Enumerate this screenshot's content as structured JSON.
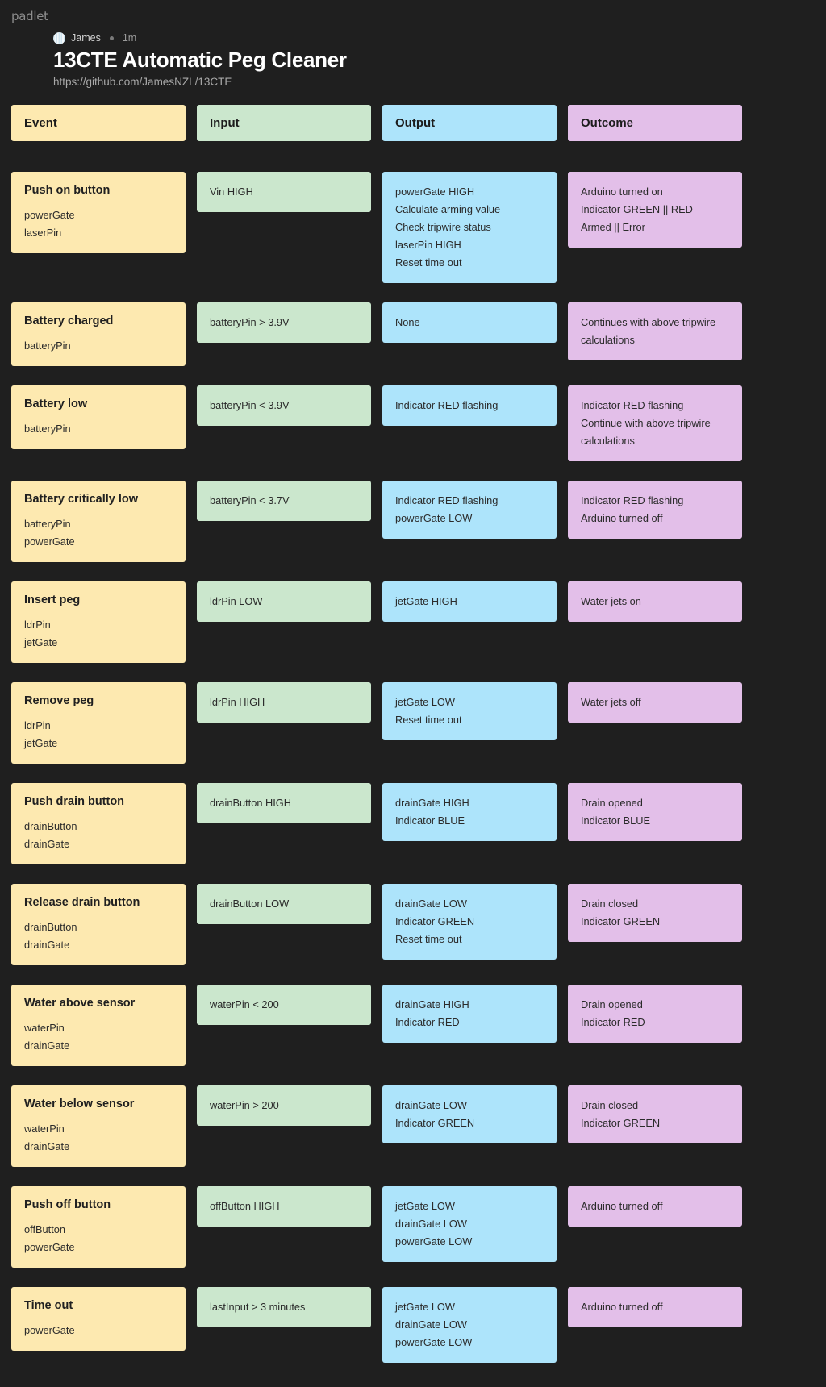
{
  "brand": "padlet",
  "header": {
    "author": "James",
    "timestamp": "1m",
    "title": "13CTE Automatic Peg Cleaner",
    "link": "https://github.com/JamesNZL/13CTE"
  },
  "colors": {
    "background": "#1f1f1f",
    "event": "#fde9b0",
    "input": "#cbe7cd",
    "output": "#ade4fb",
    "outcome": "#e3bfe9"
  },
  "columns": [
    {
      "key": "event",
      "header": "Event"
    },
    {
      "key": "input",
      "header": "Input"
    },
    {
      "key": "output",
      "header": "Output"
    },
    {
      "key": "outcome",
      "header": "Outcome"
    }
  ],
  "rows": [
    {
      "event": {
        "title": "Push on button",
        "lines": [
          "powerGate",
          "laserPin"
        ]
      },
      "input": {
        "lines": [
          "Vin HIGH"
        ]
      },
      "output": {
        "lines": [
          "powerGate HIGH",
          "Calculate arming value",
          "Check tripwire status",
          "laserPin HIGH",
          "Reset time out"
        ]
      },
      "outcome": {
        "lines": [
          "Arduino turned on",
          "Indicator GREEN || RED",
          "Armed || Error"
        ]
      }
    },
    {
      "event": {
        "title": "Battery charged",
        "lines": [
          "batteryPin"
        ]
      },
      "input": {
        "lines": [
          "batteryPin > 3.9V"
        ]
      },
      "output": {
        "lines": [
          "None"
        ]
      },
      "outcome": {
        "lines": [
          "Continues with above tripwire calculations"
        ]
      }
    },
    {
      "event": {
        "title": "Battery low",
        "lines": [
          "batteryPin"
        ]
      },
      "input": {
        "lines": [
          "batteryPin < 3.9V"
        ]
      },
      "output": {
        "lines": [
          "Indicator RED flashing"
        ]
      },
      "outcome": {
        "lines": [
          "Indicator RED flashing",
          "Continue with above tripwire calculations"
        ]
      }
    },
    {
      "event": {
        "title": "Battery critically low",
        "lines": [
          "batteryPin",
          "powerGate"
        ]
      },
      "input": {
        "lines": [
          "batteryPin < 3.7V"
        ]
      },
      "output": {
        "lines": [
          "Indicator RED flashing",
          "powerGate LOW"
        ]
      },
      "outcome": {
        "lines": [
          "Indicator RED flashing",
          "Arduino turned off"
        ]
      }
    },
    {
      "event": {
        "title": "Insert peg",
        "lines": [
          "ldrPin",
          "jetGate"
        ]
      },
      "input": {
        "lines": [
          "ldrPin LOW"
        ]
      },
      "output": {
        "lines": [
          "jetGate HIGH"
        ]
      },
      "outcome": {
        "lines": [
          "Water jets on"
        ]
      }
    },
    {
      "event": {
        "title": "Remove peg",
        "lines": [
          "ldrPin",
          "jetGate"
        ]
      },
      "input": {
        "lines": [
          "ldrPin HIGH"
        ]
      },
      "output": {
        "lines": [
          "jetGate LOW",
          "Reset time out"
        ]
      },
      "outcome": {
        "lines": [
          "Water jets off"
        ]
      }
    },
    {
      "event": {
        "title": "Push drain button",
        "lines": [
          "drainButton",
          "drainGate"
        ]
      },
      "input": {
        "lines": [
          "drainButton HIGH"
        ]
      },
      "output": {
        "lines": [
          "drainGate HIGH",
          "Indicator BLUE"
        ]
      },
      "outcome": {
        "lines": [
          "Drain opened",
          "Indicator BLUE"
        ]
      }
    },
    {
      "event": {
        "title": "Release drain button",
        "lines": [
          "drainButton",
          "drainGate"
        ]
      },
      "input": {
        "lines": [
          "drainButton LOW"
        ]
      },
      "output": {
        "lines": [
          "drainGate LOW",
          "Indicator GREEN",
          "Reset time out"
        ]
      },
      "outcome": {
        "lines": [
          "Drain closed",
          "Indicator GREEN"
        ]
      }
    },
    {
      "event": {
        "title": "Water above sensor",
        "lines": [
          "waterPin",
          "drainGate"
        ]
      },
      "input": {
        "lines": [
          "waterPin < 200"
        ]
      },
      "output": {
        "lines": [
          "drainGate HIGH",
          "Indicator RED"
        ]
      },
      "outcome": {
        "lines": [
          "Drain opened",
          "Indicator RED"
        ]
      }
    },
    {
      "event": {
        "title": "Water below sensor",
        "lines": [
          "waterPin",
          "drainGate"
        ]
      },
      "input": {
        "lines": [
          "waterPin > 200"
        ]
      },
      "output": {
        "lines": [
          "drainGate LOW",
          "Indicator GREEN"
        ]
      },
      "outcome": {
        "lines": [
          "Drain closed",
          "Indicator GREEN"
        ]
      }
    },
    {
      "event": {
        "title": "Push off button",
        "lines": [
          "offButton",
          "powerGate"
        ]
      },
      "input": {
        "lines": [
          "offButton HIGH"
        ]
      },
      "output": {
        "lines": [
          "jetGate LOW",
          "drainGate LOW",
          "powerGate LOW"
        ]
      },
      "outcome": {
        "lines": [
          "Arduino turned off"
        ]
      }
    },
    {
      "event": {
        "title": "Time out",
        "lines": [
          "powerGate"
        ]
      },
      "input": {
        "lines": [
          "lastInput > 3 minutes"
        ]
      },
      "output": {
        "lines": [
          "jetGate LOW",
          "drainGate LOW",
          "powerGate LOW"
        ]
      },
      "outcome": {
        "lines": [
          "Arduino turned off"
        ]
      }
    }
  ]
}
